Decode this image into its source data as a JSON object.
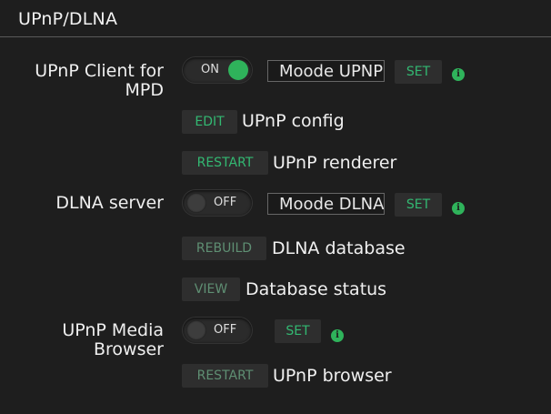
{
  "section": {
    "title": "UPnP/DLNA"
  },
  "upnp_client": {
    "label_line1": "UPnP Client for",
    "label_line2": "MPD",
    "toggle": "ON",
    "name_value": "Moode UPNP",
    "set_label": "SET",
    "edit_btn": "EDIT",
    "edit_label": "UPnP config",
    "restart_btn": "RESTART",
    "restart_label": "UPnP renderer"
  },
  "dlna_server": {
    "label": "DLNA server",
    "toggle": "OFF",
    "name_value": "Moode DLNA",
    "set_label": "SET",
    "rebuild_btn": "REBUILD",
    "rebuild_label": "DLNA database",
    "view_btn": "VIEW",
    "view_label": "Database status"
  },
  "upnp_browser": {
    "label_line1": "UPnP Media",
    "label_line2": "Browser",
    "toggle": "OFF",
    "set_label": "SET",
    "restart_btn": "RESTART",
    "restart_label": "UPnP browser"
  },
  "icons": {
    "info": "info-icon",
    "accent": "#2fb35b"
  }
}
